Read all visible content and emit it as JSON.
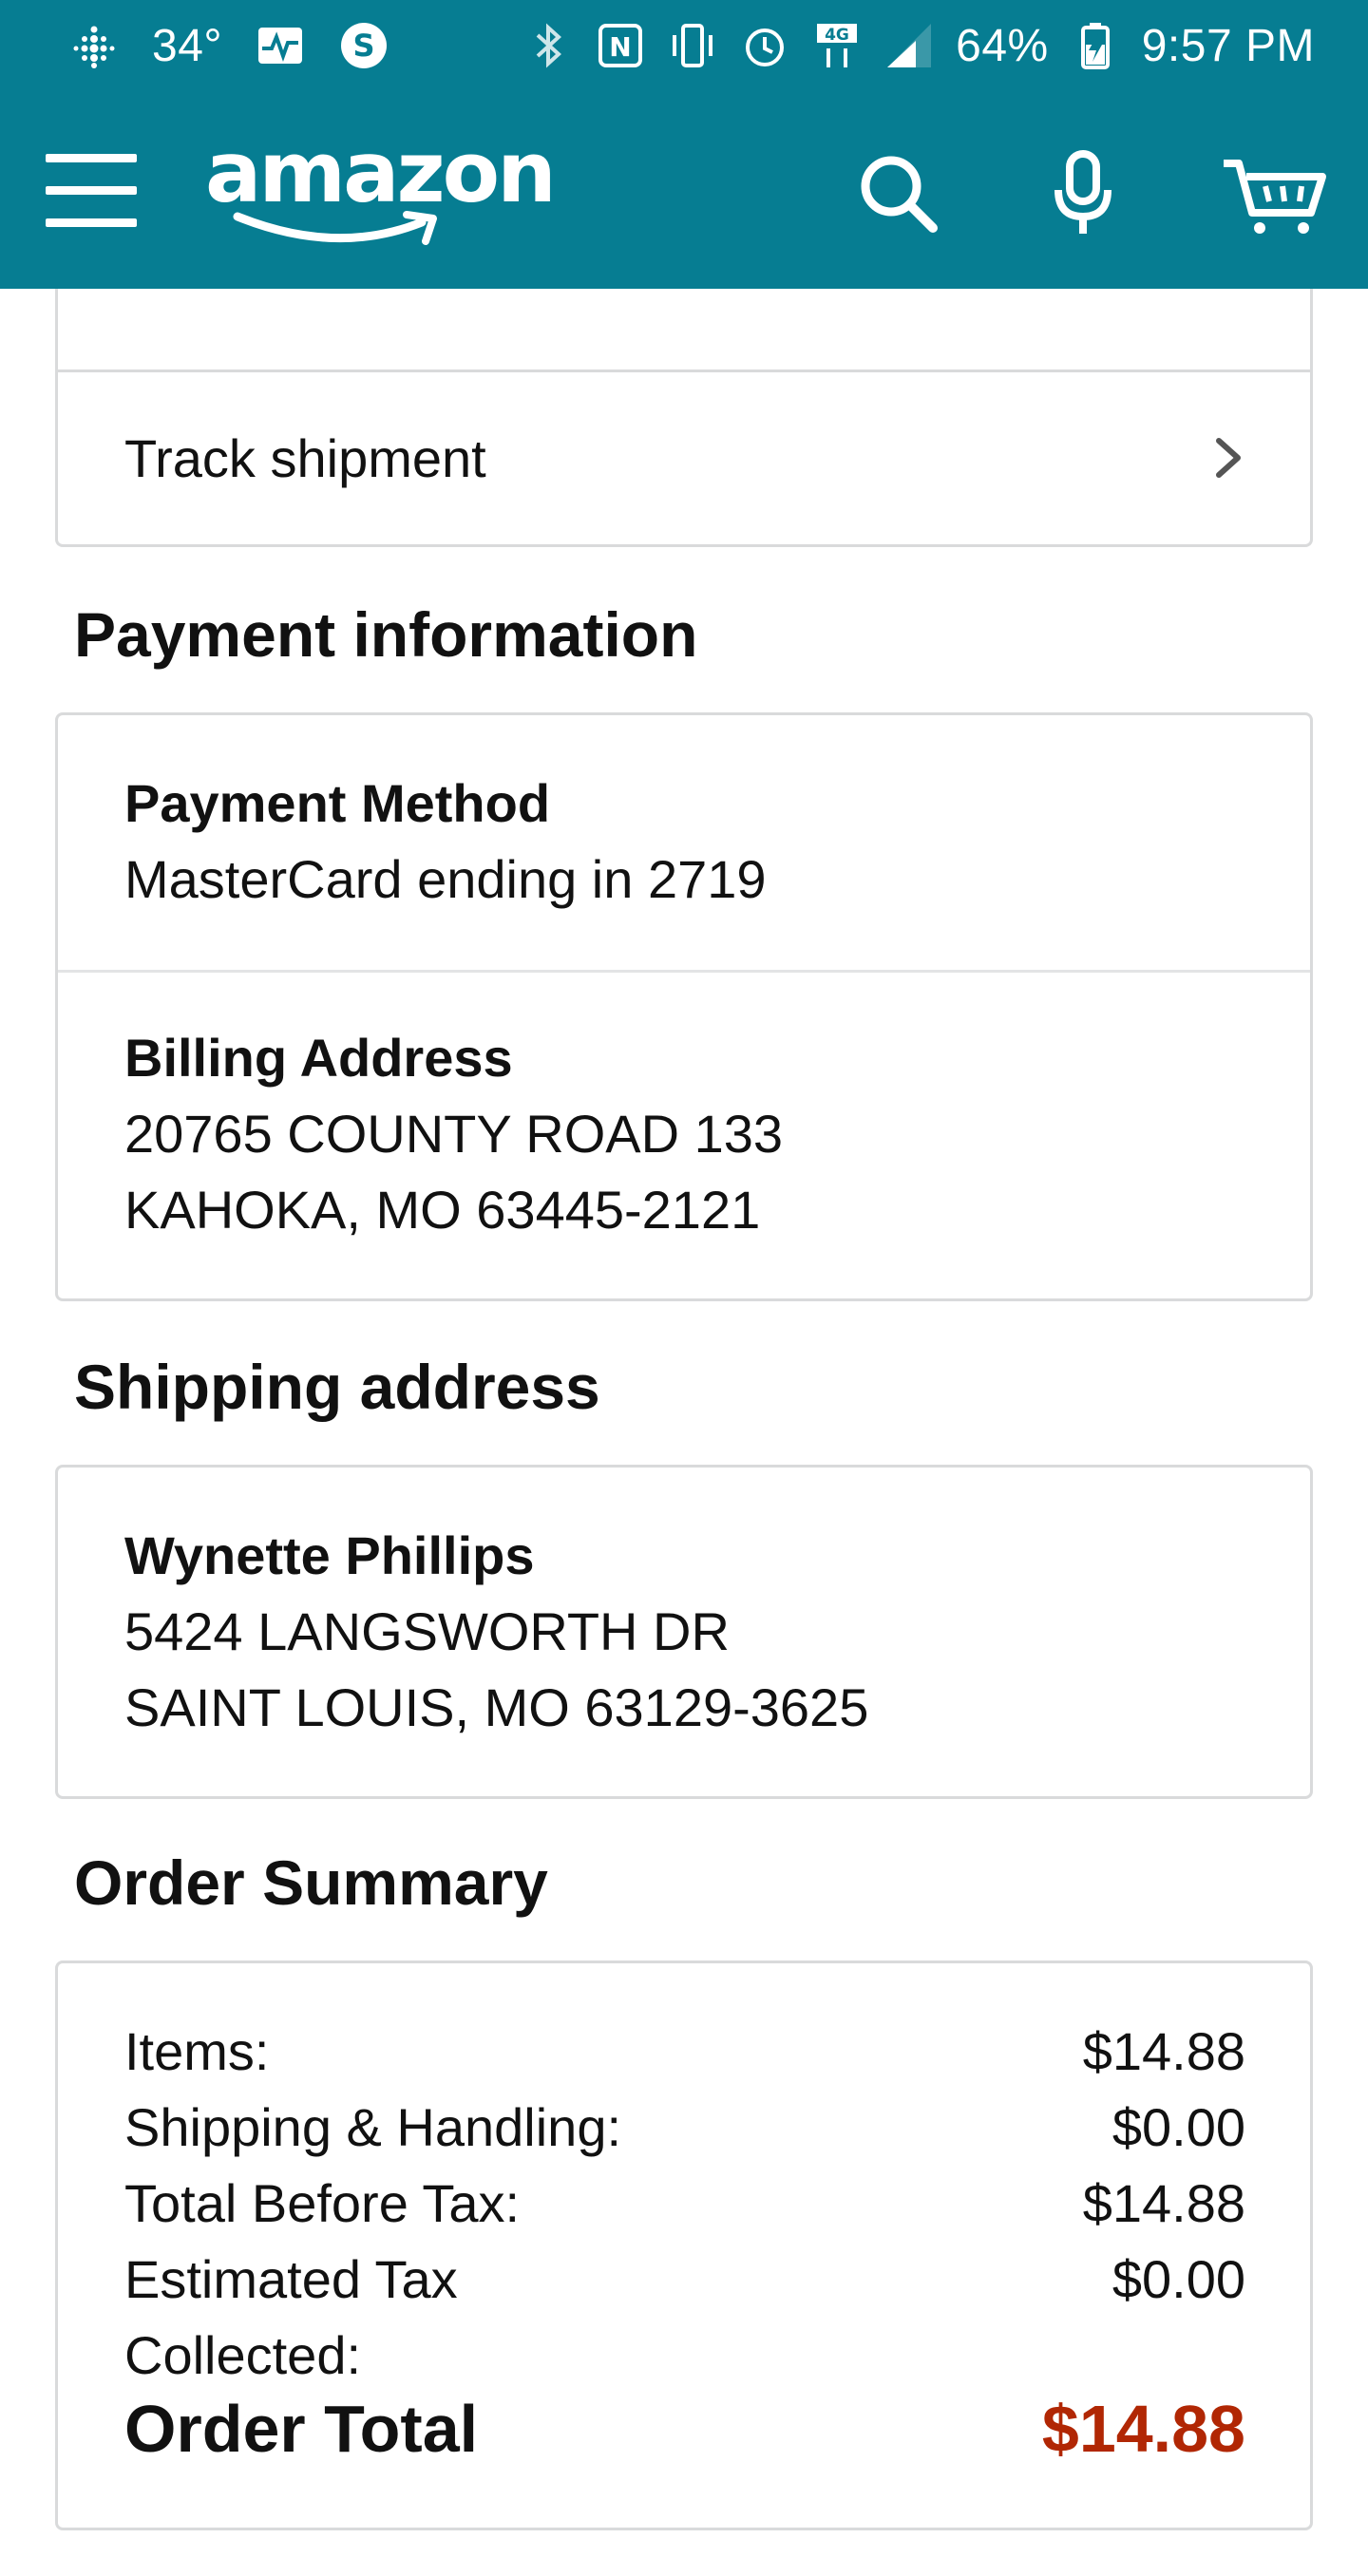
{
  "status_bar": {
    "temperature": "34°",
    "battery_percent": "64%",
    "time": "9:57 PM",
    "icons": [
      "fitbit-icon",
      "pulse-icon",
      "s-app-icon",
      "bluetooth-icon",
      "nfc-icon",
      "vibrate-icon",
      "alarm-icon",
      "4g-lte-icon",
      "signal-icon",
      "battery-charging-icon"
    ]
  },
  "header": {
    "logo_text": "amazon",
    "icons": [
      "menu-icon",
      "search-icon",
      "microphone-icon",
      "cart-icon"
    ],
    "background_color": "#067d92"
  },
  "track": {
    "label": "Track shipment"
  },
  "payment": {
    "title": "Payment information",
    "method_label": "Payment Method",
    "method_value": "MasterCard ending in 2719",
    "billing_label": "Billing Address",
    "billing_line1": "20765 COUNTY ROAD 133",
    "billing_line2": "KAHOKA, MO 63445-2121"
  },
  "shipping": {
    "title": "Shipping address",
    "name": "Wynette Phillips",
    "line1": "5424 LANGSWORTH DR",
    "line2": "SAINT LOUIS, MO 63129-3625"
  },
  "summary": {
    "title": "Order Summary",
    "rows": [
      {
        "label": "Items:",
        "value": "$14.88"
      },
      {
        "label": "Shipping & Handling:",
        "value": "$0.00"
      },
      {
        "label": "Total Before Tax:",
        "value": "$14.88"
      },
      {
        "label": "Estimated Tax",
        "value": "$0.00"
      },
      {
        "label": "Collected:",
        "value": ""
      }
    ],
    "total_label": "Order Total",
    "total_value": "$14.88",
    "total_color": "#b12704"
  }
}
